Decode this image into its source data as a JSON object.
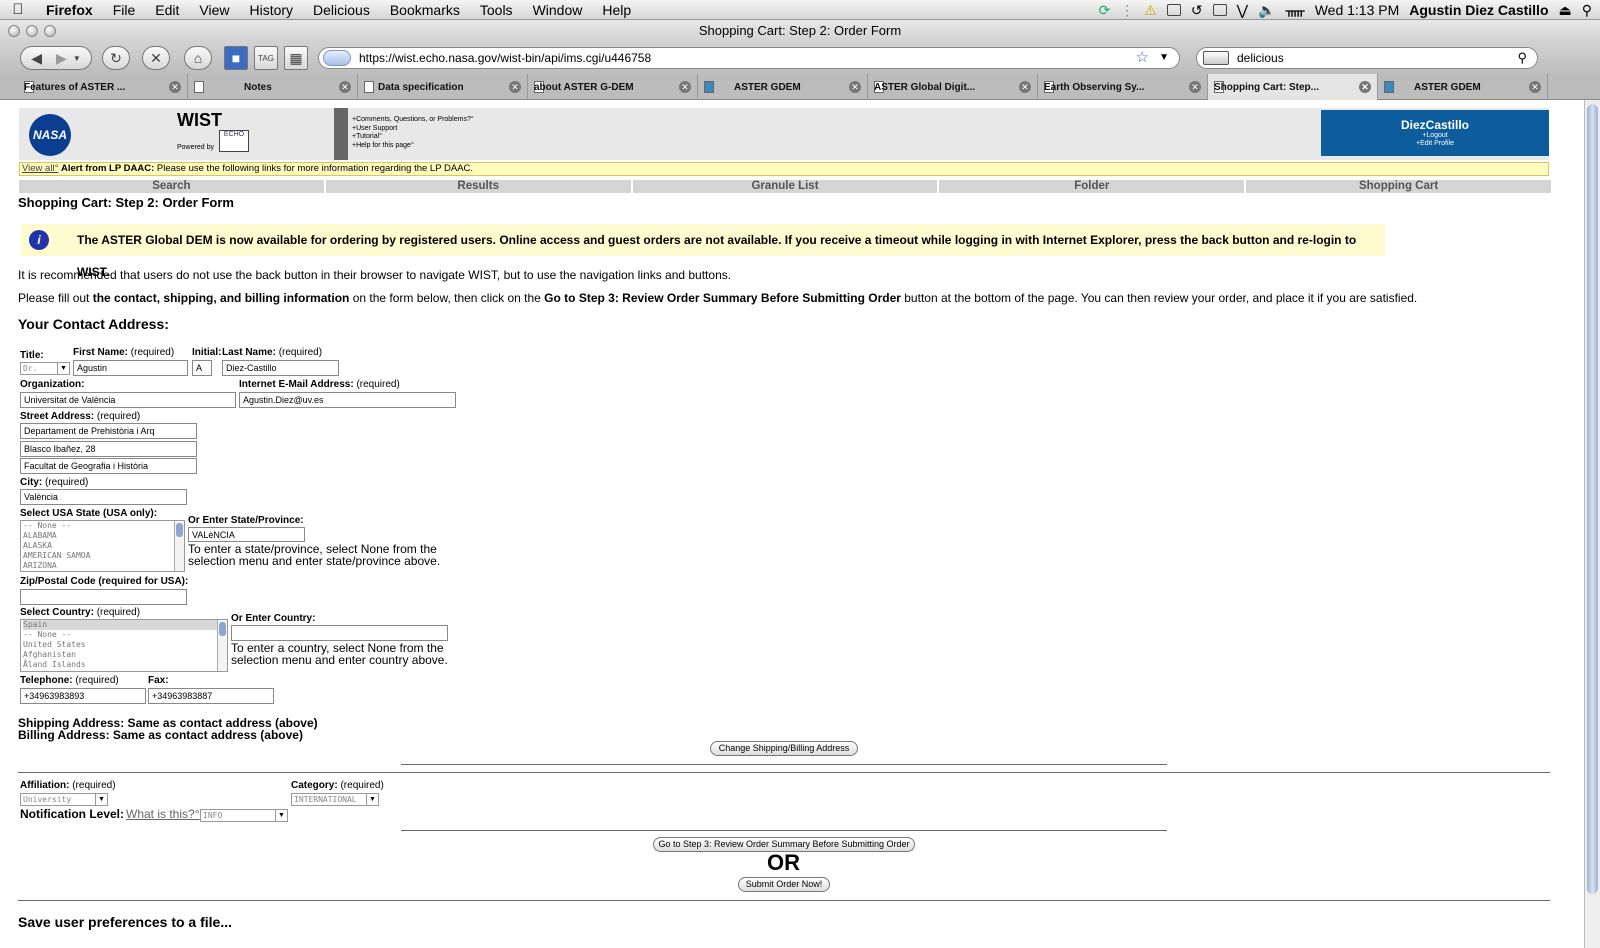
{
  "menubar": {
    "app": "Firefox",
    "items": [
      "File",
      "Edit",
      "View",
      "History",
      "Delicious",
      "Bookmarks",
      "Tools",
      "Window",
      "Help"
    ],
    "clock": "Wed 1:13 PM",
    "user": "Agustin Diez Castillo"
  },
  "window": {
    "title": "Shopping Cart: Step 2: Order Form"
  },
  "toolbar": {
    "url": "https://wist.echo.nasa.gov/wist-bin/api/ims.cgi/u446758",
    "search_value": "delicious",
    "tag_label": "TAG"
  },
  "tabs": [
    {
      "label": "Features of ASTER ..."
    },
    {
      "label": "Notes"
    },
    {
      "label": "Data specification"
    },
    {
      "label": "about ASTER G-DEM"
    },
    {
      "label": "ASTER GDEM"
    },
    {
      "label": "ASTER Global Digit..."
    },
    {
      "label": "Earth Observing Sy..."
    },
    {
      "label": "Shopping Cart: Step..."
    },
    {
      "label": "ASTER GDEM"
    }
  ],
  "header": {
    "nasa": "NASA",
    "wist": "WIST",
    "powered_by": "Powered by",
    "echo": "ECHO",
    "links": [
      "+Comments, Questions, or Problems?°",
      "+User Support",
      "+Tutorial°",
      "+Help for this page°"
    ],
    "username": "DiezCastillo",
    "logout": "+Logout",
    "edit_profile": "+Edit Profile"
  },
  "alert": {
    "view_all": "View all°",
    "title": "Alert from LP DAAC:",
    "text": "Please use the following links for more information regarding the LP DAAC."
  },
  "nav": [
    "Search",
    "Results",
    "Granule List",
    "Folder",
    "Shopping Cart"
  ],
  "page": {
    "title": "Shopping Cart: Step 2: Order Form",
    "info": "The ASTER Global DEM is now available for ordering by registered users. Online access and guest orders are not available. If you receive a timeout while logging in with Internet Explorer, press the back button and re-login to WIST.",
    "p1": "It is recommended that users do not use the back button in their browser to navigate WIST, but to use the navigation links and buttons.",
    "p2_a": "Please fill out ",
    "p2_b": "the contact, shipping, and billing information",
    "p2_c": " on the form below, then click on the ",
    "p2_d": "Go to Step 3: Review Order Summary Before Submitting Order",
    "p2_e": " button at the bottom of the page. You can then review your order, and place it if you are satisfied.",
    "contact_heading": "Your Contact Address:"
  },
  "form": {
    "required": "(required)",
    "title_label": "Title:",
    "title_value": "Dr.",
    "first_label": "First Name:",
    "first_value": "Agustin",
    "initial_label": "Initial:",
    "initial_value": "A",
    "last_label": "Last Name:",
    "last_value": "Diez-Castillo",
    "org_label": "Organization:",
    "org_value": "Universitat de València",
    "email_label": "Internet E-Mail Address:",
    "email_value": "Agustin.Diez@uv.es",
    "street_label": "Street Address:",
    "street1": "Departament de Prehistòria i Arq",
    "street2": "Blasco Ibañez, 28",
    "street3": "Facultat de Geografia i Història",
    "city_label": "City:",
    "city_value": "València",
    "state_label": "Select USA State (USA only):",
    "states": [
      "-- None --",
      "ALABAMA",
      "ALASKA",
      "AMERICAN SAMOA",
      "ARIZONA"
    ],
    "province_label": "Or Enter State/Province:",
    "province_value": "VALèNCIA",
    "province_help": "To enter a state/province, select None from the selection menu and enter state/province above.",
    "zip_label": "Zip/Postal Code (required for USA):",
    "zip_value": "",
    "country_label": "Select Country:",
    "countries": [
      "Spain",
      "-- None --",
      "United States",
      "Afghanistan",
      "Åland Islands"
    ],
    "enter_country_label": "Or Enter Country:",
    "country_value": "",
    "country_help": "To enter a country, select None from the selection menu and enter country above.",
    "tel_label": "Telephone:",
    "tel_value": "+34963983893",
    "fax_label": "Fax:",
    "fax_value": "+34963983887",
    "shipping": "Shipping Address: Same as contact address (above)",
    "billing": "Billing Address: Same as contact address (above)",
    "change_btn": "Change Shipping/Billing Address",
    "affiliation_label": "Affiliation:",
    "affiliation_value": "University",
    "category_label": "Category:",
    "category_value": "INTERNATIONAL",
    "notify_label": "Notification Level:",
    "notify_link": "What is this?°",
    "notify_value": "INFO",
    "step3_btn": "Go to Step 3: Review Order Summary Before Submitting Order",
    "or": "OR",
    "submit_btn": "Submit Order Now!",
    "save_prefs": "Save user preferences to a file..."
  }
}
